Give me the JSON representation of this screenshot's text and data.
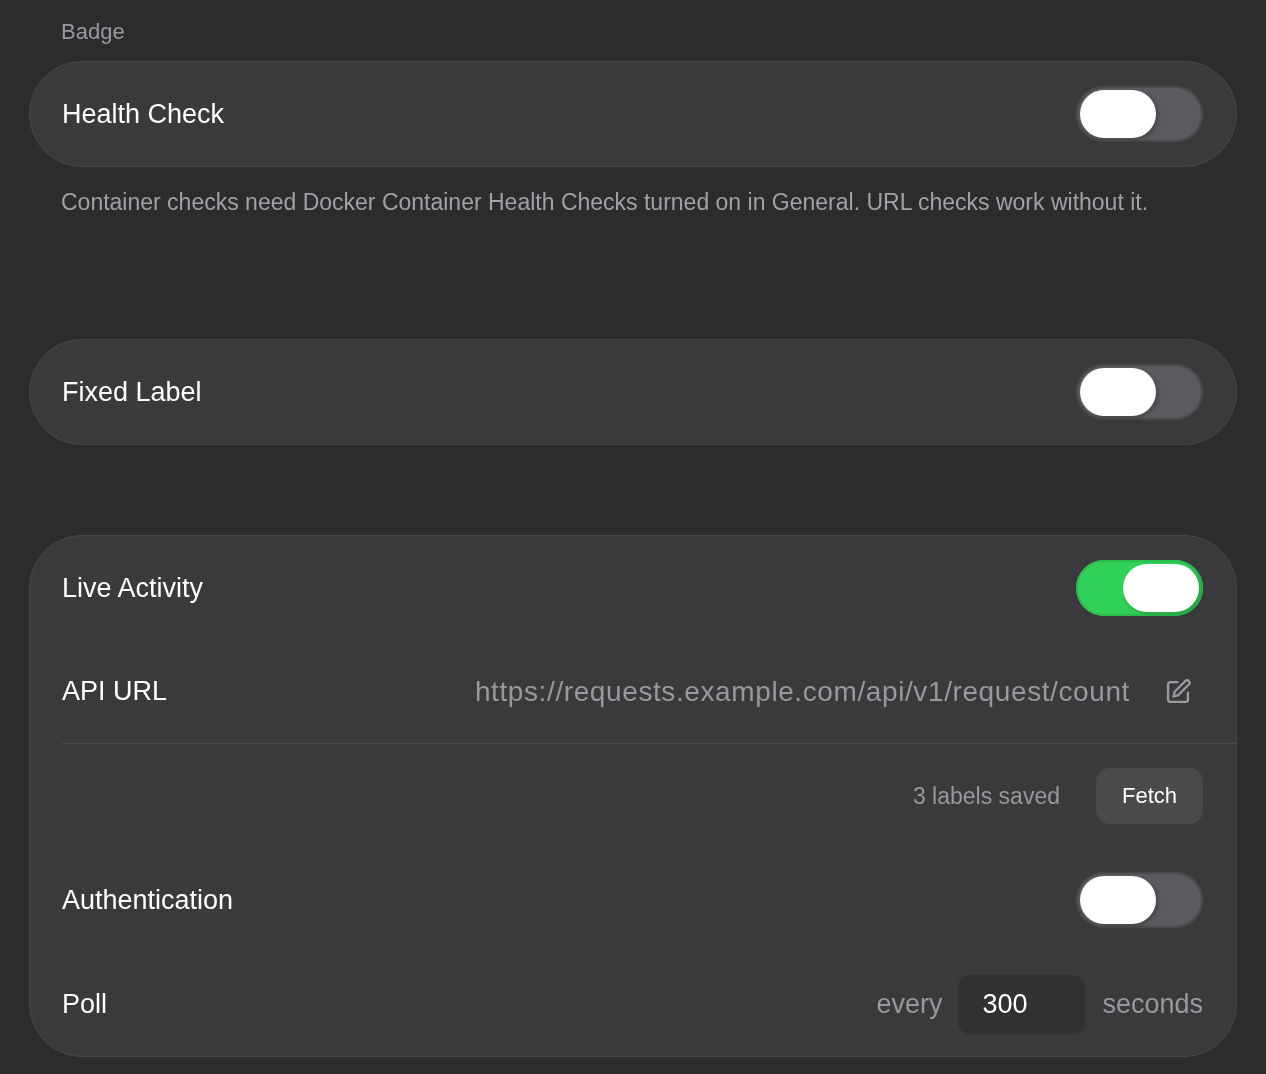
{
  "sections": [
    {
      "header": "Badge",
      "rows": [
        {
          "kind": "toggle",
          "label": "Health Check",
          "on": false
        }
      ],
      "footer": "Container checks need Docker Container Health Checks turned on in General. URL checks work without it."
    },
    {
      "rows": [
        {
          "kind": "toggle",
          "label": "Fixed Label",
          "on": false
        }
      ]
    },
    {
      "rows": [
        {
          "kind": "toggle",
          "label": "Live Activity",
          "on": true
        },
        {
          "kind": "url",
          "label": "API URL",
          "value": "https://requests.example.com/api/v1/request/count"
        },
        {
          "kind": "action",
          "status": "3 labels saved",
          "button": "Fetch"
        },
        {
          "kind": "toggle",
          "label": "Authentication",
          "on": false
        },
        {
          "kind": "number",
          "label": "Poll",
          "prefix": "every",
          "value": "300",
          "suffix": "seconds"
        }
      ]
    }
  ]
}
